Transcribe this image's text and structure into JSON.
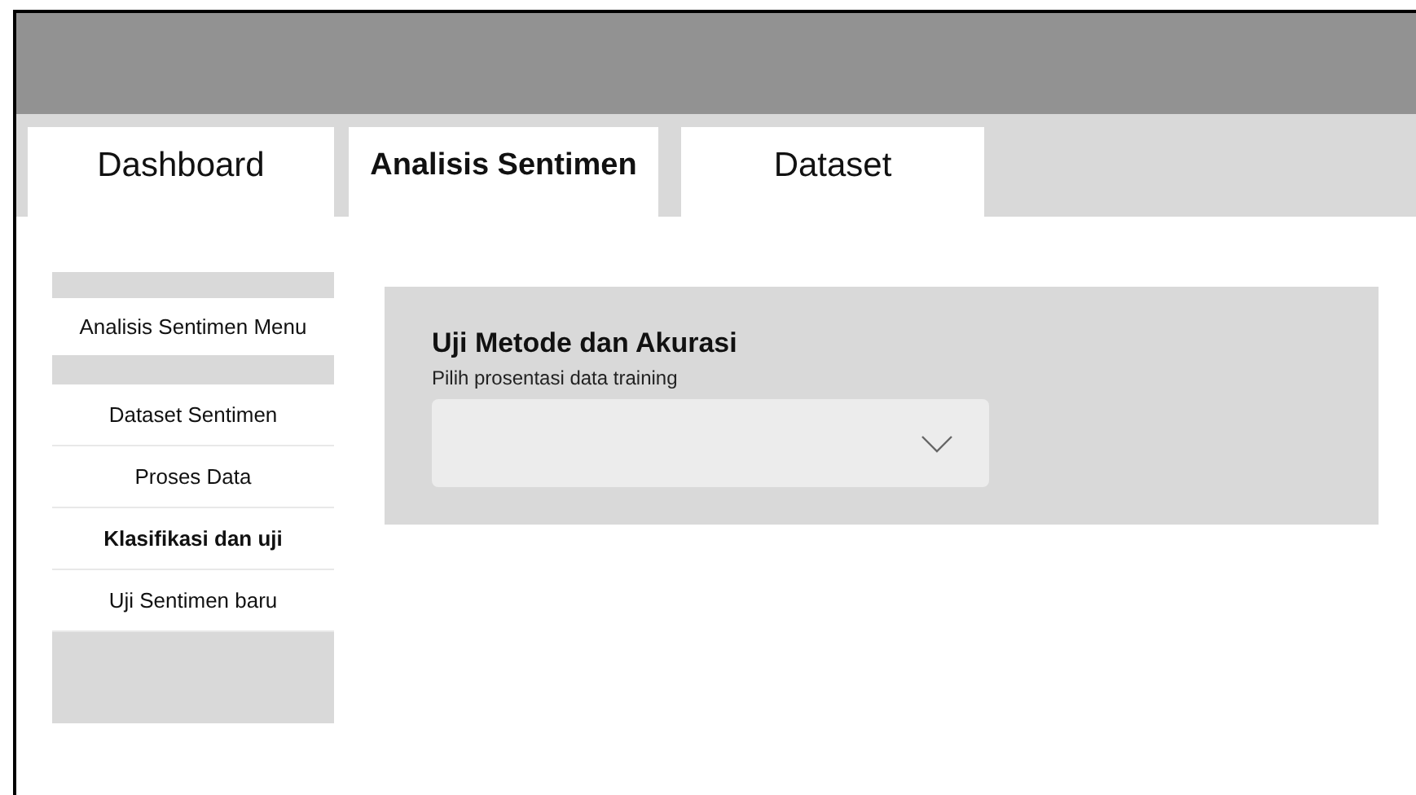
{
  "tabs": [
    {
      "label": "Dashboard",
      "selected": false
    },
    {
      "label": "Analisis Sentimen",
      "selected": true
    },
    {
      "label": "Dataset",
      "selected": false
    }
  ],
  "sidebar": {
    "title": "Analisis Sentimen Menu",
    "items": [
      {
        "label": "Dataset Sentimen",
        "selected": false
      },
      {
        "label": "Proses Data",
        "selected": false
      },
      {
        "label": "Klasifikasi dan uji",
        "selected": true
      },
      {
        "label": "Uji Sentimen baru",
        "selected": false
      }
    ]
  },
  "panel": {
    "title": "Uji Metode dan Akurasi",
    "label": "Pilih prosentasi data training"
  }
}
